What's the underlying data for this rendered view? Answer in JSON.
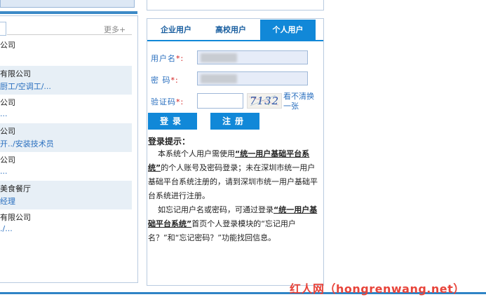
{
  "left": {
    "more_label": "更多+",
    "items": [
      {
        "title": "公司",
        "subtitle": "",
        "shaded": false
      },
      {
        "title": "有限公司",
        "subtitle": "厨工/空调工/...",
        "shaded": true
      },
      {
        "title": "公司",
        "subtitle": "...",
        "shaded": false
      },
      {
        "title": "公司",
        "subtitle": "开../安装技术员",
        "shaded": true
      },
      {
        "title": "公司",
        "subtitle": "...",
        "shaded": false
      },
      {
        "title": "美食餐厅",
        "subtitle": "经理",
        "shaded": true
      },
      {
        "title": "有限公司",
        "subtitle": "./...",
        "shaded": false
      }
    ]
  },
  "login": {
    "tabs": [
      {
        "label": "企业用户",
        "active": false
      },
      {
        "label": "高校用户",
        "active": false
      },
      {
        "label": "个人用户",
        "active": true
      }
    ],
    "username_label": "用户名",
    "password_label": "密  码",
    "captcha_label": "验证码",
    "required_mark": "*:",
    "captcha_text": "7132",
    "refresh_link": "看不清换一张",
    "login_button": "登录",
    "register_button": "注册",
    "hint_title": "登录提示：",
    "hint_p1_a": "本系统个人用户需使用",
    "hint_p1_link": "“统一用户基础平台系统”",
    "hint_p1_b": "的个人账号及密码登录；未在深圳市统一用户基础平台系统注册的，请到深圳市统一用户基础平台系统进行注册。",
    "hint_p2_a": "如忘记用户名或密码，可通过登录",
    "hint_p2_link": "“统一用户基础平台系统”",
    "hint_p2_b": "首页个人登录模块的“忘记用户名？”和“忘记密码？”功能找回信息。"
  },
  "watermark": "红人网（hongrenwang.net）",
  "colors": {
    "accent": "#1188d8",
    "link": "#2a6fbf",
    "required": "#d01818",
    "watermark": "#e8443a"
  }
}
